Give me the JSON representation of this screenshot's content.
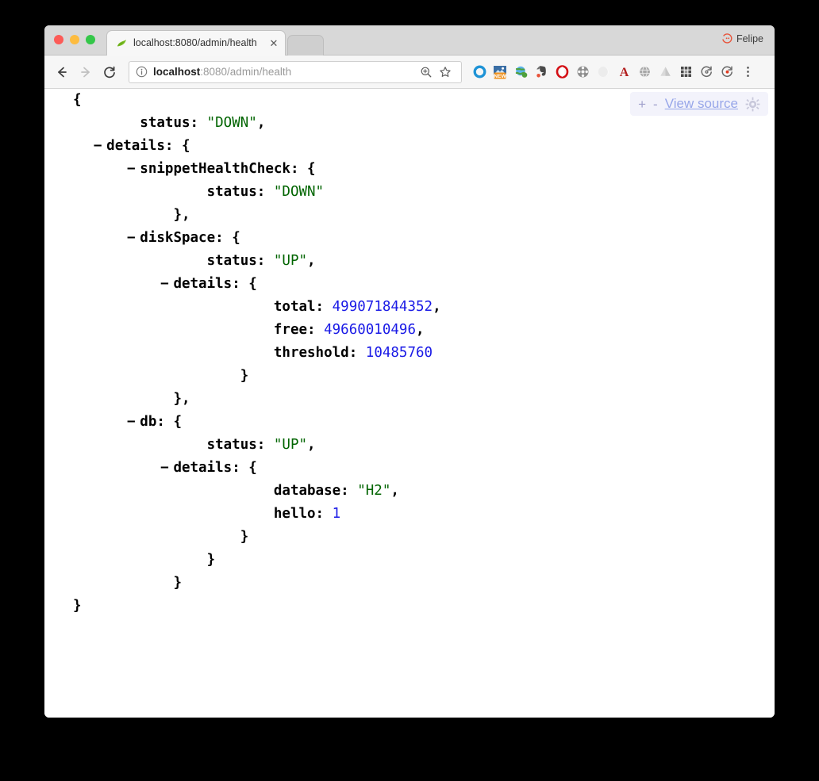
{
  "window": {
    "traffic_lights": [
      "close",
      "minimize",
      "maximize"
    ],
    "profile_name": "Felipe"
  },
  "tab": {
    "title": "localhost:8080/admin/health",
    "favicon": "spring-leaf-icon",
    "close_label": "✕"
  },
  "toolbar": {
    "back_label": "←",
    "forward_label": "→",
    "reload_label": "C",
    "omnibox": {
      "info_icon": "info-circle-icon",
      "url_host": "localhost",
      "url_path": ":8080/admin/health",
      "url_full": "localhost:8080/admin/health",
      "zoom_icon": "zoom-in-icon",
      "bookmark_icon": "star-icon"
    },
    "extensions": [
      {
        "name": "blue-ring-icon",
        "label": "O"
      },
      {
        "name": "new-badge-icon",
        "label": "NEW"
      },
      {
        "name": "globe-green-icon",
        "label": ""
      },
      {
        "name": "evernote-icon",
        "label": ""
      },
      {
        "name": "opera-icon",
        "label": "O"
      },
      {
        "name": "film-reel-icon",
        "label": ""
      },
      {
        "name": "pale-circle-icon",
        "label": ""
      },
      {
        "name": "red-a-icon",
        "label": "A"
      },
      {
        "name": "grey-globe-icon",
        "label": ""
      },
      {
        "name": "drive-triangle-icon",
        "label": ""
      },
      {
        "name": "apps-grid-icon",
        "label": ""
      },
      {
        "name": "refresh-circle-icon",
        "label": ""
      },
      {
        "name": "refresh-circle-alert-icon",
        "label": ""
      },
      {
        "name": "overflow-menu-icon",
        "label": "⋮"
      }
    ]
  },
  "json_viewer": {
    "expand_label": "+",
    "collapse_label": "-",
    "view_source_label": "View source",
    "settings_icon": "gear-icon",
    "collapse_marker": "−",
    "lines": [
      {
        "indent": 0,
        "marker": false,
        "parts": [
          {
            "t": "{",
            "c": "jpun"
          }
        ]
      },
      {
        "indent": 2,
        "marker": false,
        "parts": [
          {
            "t": "status: ",
            "c": "jkey"
          },
          {
            "t": "\"DOWN\"",
            "c": "jstr"
          },
          {
            "t": ",",
            "c": "jpun"
          }
        ]
      },
      {
        "indent": 1,
        "marker": true,
        "parts": [
          {
            "t": "details: ",
            "c": "jkey"
          },
          {
            "t": "{",
            "c": "jpun"
          }
        ]
      },
      {
        "indent": 2,
        "marker": true,
        "parts": [
          {
            "t": "snippetHealthCheck: ",
            "c": "jkey"
          },
          {
            "t": "{",
            "c": "jpun"
          }
        ]
      },
      {
        "indent": 4,
        "marker": false,
        "parts": [
          {
            "t": "status: ",
            "c": "jkey"
          },
          {
            "t": "\"DOWN\"",
            "c": "jstr"
          }
        ]
      },
      {
        "indent": 3,
        "marker": false,
        "parts": [
          {
            "t": "},",
            "c": "jpun"
          }
        ]
      },
      {
        "indent": 2,
        "marker": true,
        "parts": [
          {
            "t": "diskSpace: ",
            "c": "jkey"
          },
          {
            "t": "{",
            "c": "jpun"
          }
        ]
      },
      {
        "indent": 4,
        "marker": false,
        "parts": [
          {
            "t": "status: ",
            "c": "jkey"
          },
          {
            "t": "\"UP\"",
            "c": "jstr"
          },
          {
            "t": ",",
            "c": "jpun"
          }
        ]
      },
      {
        "indent": 3,
        "marker": true,
        "parts": [
          {
            "t": "details: ",
            "c": "jkey"
          },
          {
            "t": "{",
            "c": "jpun"
          }
        ]
      },
      {
        "indent": 6,
        "marker": false,
        "parts": [
          {
            "t": "total: ",
            "c": "jkey"
          },
          {
            "t": "499071844352",
            "c": "jnum"
          },
          {
            "t": ",",
            "c": "jpun"
          }
        ]
      },
      {
        "indent": 6,
        "marker": false,
        "parts": [
          {
            "t": "free: ",
            "c": "jkey"
          },
          {
            "t": "49660010496",
            "c": "jnum"
          },
          {
            "t": ",",
            "c": "jpun"
          }
        ]
      },
      {
        "indent": 6,
        "marker": false,
        "parts": [
          {
            "t": "threshold: ",
            "c": "jkey"
          },
          {
            "t": "10485760",
            "c": "jnum"
          }
        ]
      },
      {
        "indent": 5,
        "marker": false,
        "parts": [
          {
            "t": "}",
            "c": "jpun"
          }
        ]
      },
      {
        "indent": 3,
        "marker": false,
        "parts": [
          {
            "t": "},",
            "c": "jpun"
          }
        ]
      },
      {
        "indent": 2,
        "marker": true,
        "parts": [
          {
            "t": "db: ",
            "c": "jkey"
          },
          {
            "t": "{",
            "c": "jpun"
          }
        ]
      },
      {
        "indent": 4,
        "marker": false,
        "parts": [
          {
            "t": "status: ",
            "c": "jkey"
          },
          {
            "t": "\"UP\"",
            "c": "jstr"
          },
          {
            "t": ",",
            "c": "jpun"
          }
        ]
      },
      {
        "indent": 3,
        "marker": true,
        "parts": [
          {
            "t": "details: ",
            "c": "jkey"
          },
          {
            "t": "{",
            "c": "jpun"
          }
        ]
      },
      {
        "indent": 6,
        "marker": false,
        "parts": [
          {
            "t": "database: ",
            "c": "jkey"
          },
          {
            "t": "\"H2\"",
            "c": "jstr"
          },
          {
            "t": ",",
            "c": "jpun"
          }
        ]
      },
      {
        "indent": 6,
        "marker": false,
        "parts": [
          {
            "t": "hello: ",
            "c": "jkey"
          },
          {
            "t": "1",
            "c": "jnum"
          }
        ]
      },
      {
        "indent": 5,
        "marker": false,
        "parts": [
          {
            "t": "}",
            "c": "jpun"
          }
        ]
      },
      {
        "indent": 4,
        "marker": false,
        "parts": [
          {
            "t": "}",
            "c": "jpun"
          }
        ]
      },
      {
        "indent": 3,
        "marker": false,
        "parts": [
          {
            "t": "}",
            "c": "jpun"
          }
        ]
      },
      {
        "indent": 0,
        "marker": false,
        "parts": [
          {
            "t": "}",
            "c": "jpun"
          }
        ]
      }
    ]
  },
  "colors": {
    "string_green": "#006400",
    "number_blue": "#1a1ae6",
    "link_blue": "#8f9fe8",
    "chrome_grey": "#d8d8d8",
    "toolbar_grey": "#f6f6f6"
  }
}
